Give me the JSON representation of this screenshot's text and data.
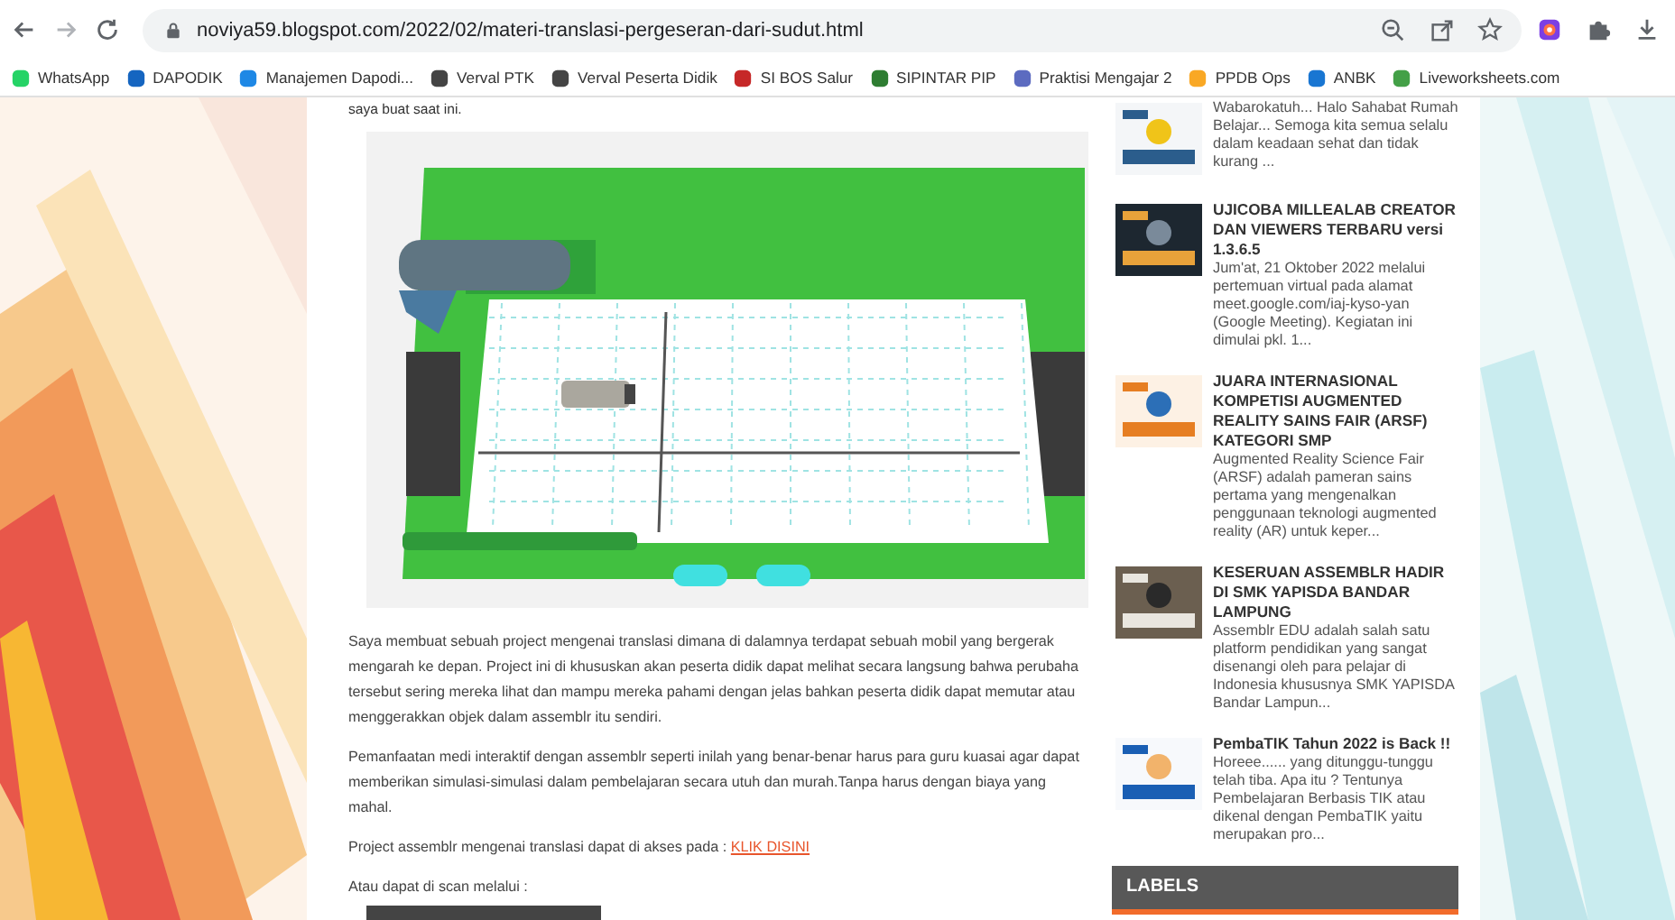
{
  "browser": {
    "url": "noviya59.blogspot.com/2022/02/materi-translasi-pergeseran-dari-sudut.html"
  },
  "bookmarks": [
    {
      "label": "WhatsApp",
      "color": "#25d366"
    },
    {
      "label": "DAPODIK",
      "color": "#1565c0"
    },
    {
      "label": "Manajemen Dapodi...",
      "color": "#1e88e5"
    },
    {
      "label": "Verval PTK",
      "color": "#444444"
    },
    {
      "label": "Verval Peserta Didik",
      "color": "#444444"
    },
    {
      "label": "SI BOS Salur",
      "color": "#c62828"
    },
    {
      "label": "SIPINTAR PIP",
      "color": "#2e7d32"
    },
    {
      "label": "Praktisi Mengajar 2",
      "color": "#5c6bc0"
    },
    {
      "label": "PPDB Ops",
      "color": "#f9a825"
    },
    {
      "label": "ANBK",
      "color": "#1976d2"
    },
    {
      "label": "Liveworksheets.com",
      "color": "#43a047"
    }
  ],
  "article": {
    "intro": "saya buat saat ini.",
    "paragraphs": [
      "Saya membuat sebuah project mengenai translasi dimana di dalamnya terdapat sebuah mobil yang bergerak mengarah ke depan. Project ini di khususkan akan peserta didik dapat melihat secara langsung bahwa perubaha tersebut sering mereka lihat dan mampu mereka pahami dengan jelas bahkan peserta didik dapat memutar atau menggerakkan objek dalam assemblr itu sendiri.",
      "Pemanfaatan medi interaktif dengan assemblr seperti inilah yang benar-benar harus para guru kuasai agar dapat memberikan simulasi-simulasi dalam pembelajaran secara utuh dan murah.Tanpa harus dengan biaya yang mahal."
    ],
    "link_line": {
      "text": "Project assemblr mengenai translasi dapat di akses pada :",
      "link": "KLIK DISINI"
    },
    "scan_line": "Atau dapat di scan melalui :"
  },
  "sidebar": {
    "posts": [
      {
        "snippet": "Wabarokatuh... Halo Sahabat Rumah Belajar... Semoga kita semua selalu dalam keadaan sehat dan tidak kurang ..."
      },
      {
        "title": "UJICOBA MILLEALAB CREATOR DAN VIEWERS TERBARU versi 1.3.6.5",
        "snippet": "Jum'at, 21 Oktober 2022 melalui pertemuan virtual pada alamat meet.google.com/iaj-kyso-yan (Google Meeting). Kegiatan ini dimulai pkl. 1..."
      },
      {
        "title": "JUARA INTERNASIONAL KOMPETISI AUGMENTED REALITY SAINS FAIR (ARSF) KATEGORI SMP",
        "snippet": "Augmented Reality Science Fair (ARSF)  adalah pameran sains pertama yang mengenalkan penggunaan teknologi augmented reality (AR) untuk keper..."
      },
      {
        "title": "KESERUAN ASSEMBLR HADIR DI SMK YAPISDA BANDAR LAMPUNG",
        "snippet": "Assemblr EDU  adalah salah satu platform pendidikan yang sangat disenangi oleh para pelajar di Indonesia khususnya SMK YAPISDA Bandar Lampun..."
      },
      {
        "title": "PembaTIK Tahun 2022 is Back !!",
        "snippet": "Horeee...... yang ditunggu-tunggu telah tiba. Apa itu ? Tentunya Pembelajaran Berbasis TIK atau dikenal dengan PembaTIK yaitu merupakan pro..."
      }
    ],
    "labels_heading": "LABELS"
  }
}
